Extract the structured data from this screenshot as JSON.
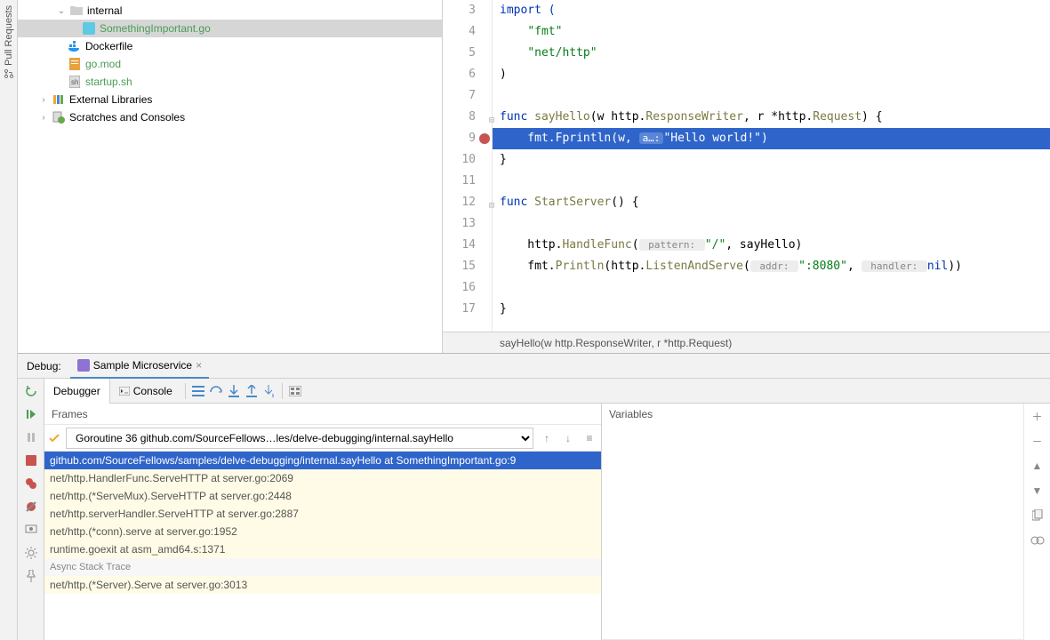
{
  "sidebar": {
    "pull_requests": "Pull Requests"
  },
  "tree": {
    "internal": "internal",
    "file_go": "SomethingImportant.go",
    "dockerfile": "Dockerfile",
    "gomod": "go.mod",
    "startup": "startup.sh",
    "extlib": "External Libraries",
    "scratch": "Scratches and Consoles"
  },
  "code": {
    "l3": "import (",
    "l4_str": "\"fmt\"",
    "l5_str": "\"net/http\"",
    "l6": ")",
    "l8_kw": "func ",
    "l8_fn": "sayHello",
    "l8_sig1": "(w http.",
    "l8_sig2": "ResponseWriter",
    "l8_sig3": ", r *http.",
    "l8_sig4": "Request",
    "l8_sig5": ") {",
    "l9_a": "    fmt.",
    "l9_fn": "Fprintln",
    "l9_b": "(w, ",
    "l9_hint": "a…:",
    "l9_str": "\"Hello world!\"",
    "l9_c": ")",
    "l10": "}",
    "l12_kw": "func ",
    "l12_fn": "StartServer",
    "l12_sig": "() {",
    "l14_a": "    http.",
    "l14_fn": "HandleFunc",
    "l14_b": "(",
    "l14_hint": " pattern: ",
    "l14_str": "\"/\"",
    "l14_c": ", sayHello)",
    "l15_a": "    fmt.",
    "l15_fn": "Println",
    "l15_b": "(http.",
    "l15_fn2": "ListenAndServe",
    "l15_c": "(",
    "l15_hint1": " addr: ",
    "l15_str": "\":8080\"",
    "l15_d": ", ",
    "l15_hint2": " handler: ",
    "l15_nil": "nil",
    "l15_e": "))",
    "l17": "}"
  },
  "line_numbers": [
    "3",
    "4",
    "5",
    "6",
    "7",
    "8",
    "9",
    "10",
    "11",
    "12",
    "13",
    "14",
    "15",
    "16",
    "17"
  ],
  "breadcrumb": "sayHello(w http.ResponseWriter, r *http.Request)",
  "debug": {
    "title": "Debug:",
    "tab": "Sample Microservice",
    "debugger": "Debugger",
    "console": "Console",
    "frames": "Frames",
    "variables": "Variables",
    "goroutine": "Goroutine 36 github.com/SourceFellows…les/delve-debugging/internal.sayHello",
    "stack0": "github.com/SourceFellows/samples/delve-debugging/internal.sayHello at SomethingImportant.go:9",
    "stack1": "net/http.HandlerFunc.ServeHTTP at server.go:2069",
    "stack2": "net/http.(*ServeMux).ServeHTTP at server.go:2448",
    "stack3": "net/http.serverHandler.ServeHTTP at server.go:2887",
    "stack4": "net/http.(*conn).serve at server.go:1952",
    "stack5": "runtime.goexit at asm_amd64.s:1371",
    "async_hdr": "Async Stack Trace",
    "stack6": "net/http.(*Server).Serve at server.go:3013"
  }
}
